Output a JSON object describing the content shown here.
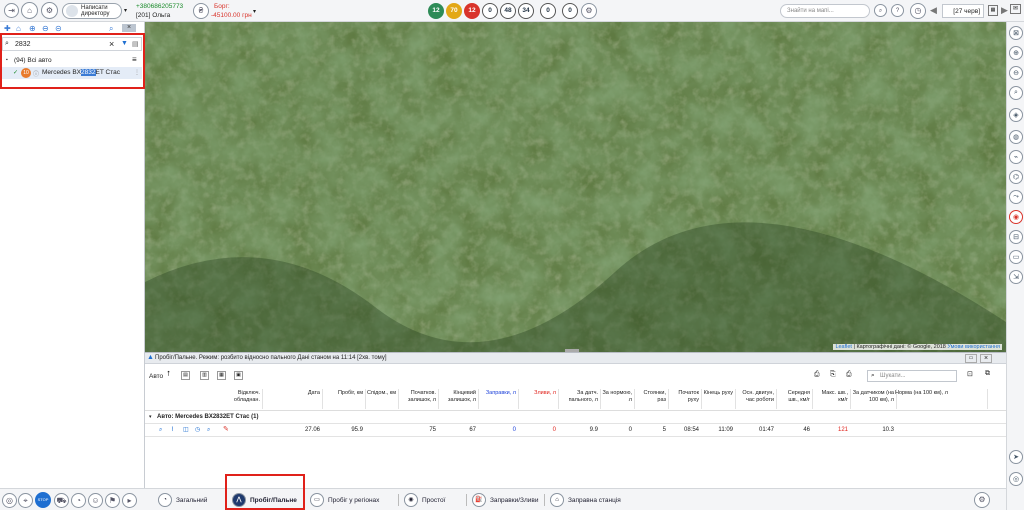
{
  "toolbar": {
    "write_director": "Написати директору",
    "phone": "+380686205773",
    "user": "[201] Ольга",
    "debt_label": "Борг:",
    "debt_value": "-45100.00 грн",
    "counters": [
      {
        "value": "12",
        "color": "#2e8b57"
      },
      {
        "value": "70",
        "color": "#e3a817"
      },
      {
        "value": "12",
        "color": "#d9342b"
      },
      {
        "value": "0",
        "color": "#ffffff"
      },
      {
        "value": "48",
        "color": "#ffffff"
      },
      {
        "value": "34",
        "color": "#ffffff"
      },
      {
        "value": "0",
        "color": "#ffffff"
      },
      {
        "value": "0",
        "color": "#ffffff"
      }
    ],
    "map_search_placeholder": "Знайти на мапі...",
    "date": "[27 черв]"
  },
  "left_panel": {
    "search_value": "2832",
    "group_label": "(94) Всі авто",
    "vehicle_prefix": "Mercedes BX",
    "vehicle_highlight": "2832",
    "vehicle_suffix": "ET Стас",
    "vehicle_badge": "10"
  },
  "map": {
    "attribution_leaflet": "Leaflet",
    "attribution_text": " | Картографічні дані: © Google, 2018 ",
    "attribution_terms": "Умови використання"
  },
  "report": {
    "title": "Пробіг/Пальне. Режим: розбито відносно пального Дані станом на 11:14 [2хв. тому]",
    "auto_label": "Авто",
    "search_placeholder": "Шукати...",
    "columns": [
      "Відключ. обладнан.",
      "Дата",
      "Пробіг, км",
      "Спідом., км",
      "Початков. залишок, л",
      "Кінцевий залишок, л",
      "Заправки, л",
      "Зливи, л",
      "За датч. пального, л",
      "За нормою, л",
      "Стоянки, раз",
      "Початок руху",
      "Кінець руху",
      "Осн. двигун, час роботи",
      "Середня шв., км/г",
      "Макс. шв., км/г",
      "За датчиком (на 100 км), л",
      "Норма (на 100 км), л"
    ],
    "group_row": "Авто: Mercedes BX2832ET Стас (1)",
    "row": [
      "",
      "27.06",
      "95.9",
      "",
      "75",
      "67",
      "0",
      "0",
      "9.9",
      "0",
      "5",
      "08:54",
      "11:09",
      "01:47",
      "46",
      "121",
      "10.3",
      ""
    ]
  },
  "bottom_tabs": [
    {
      "label": "Загальний",
      "icon": "chart-icon"
    },
    {
      "label": "Пробіг/Пальне",
      "icon": "road-icon"
    },
    {
      "label": "Пробіг у регіонах",
      "icon": "region-icon"
    },
    {
      "label": "Простої",
      "icon": "stop-icon"
    },
    {
      "label": "Заправки/Зливи",
      "icon": "fuel-icon"
    },
    {
      "label": "Заправна станція",
      "icon": "station-icon"
    }
  ],
  "colors": {
    "accent": "#1f6fd1",
    "red": "#e0211a",
    "blue": "#1a3fd9"
  }
}
